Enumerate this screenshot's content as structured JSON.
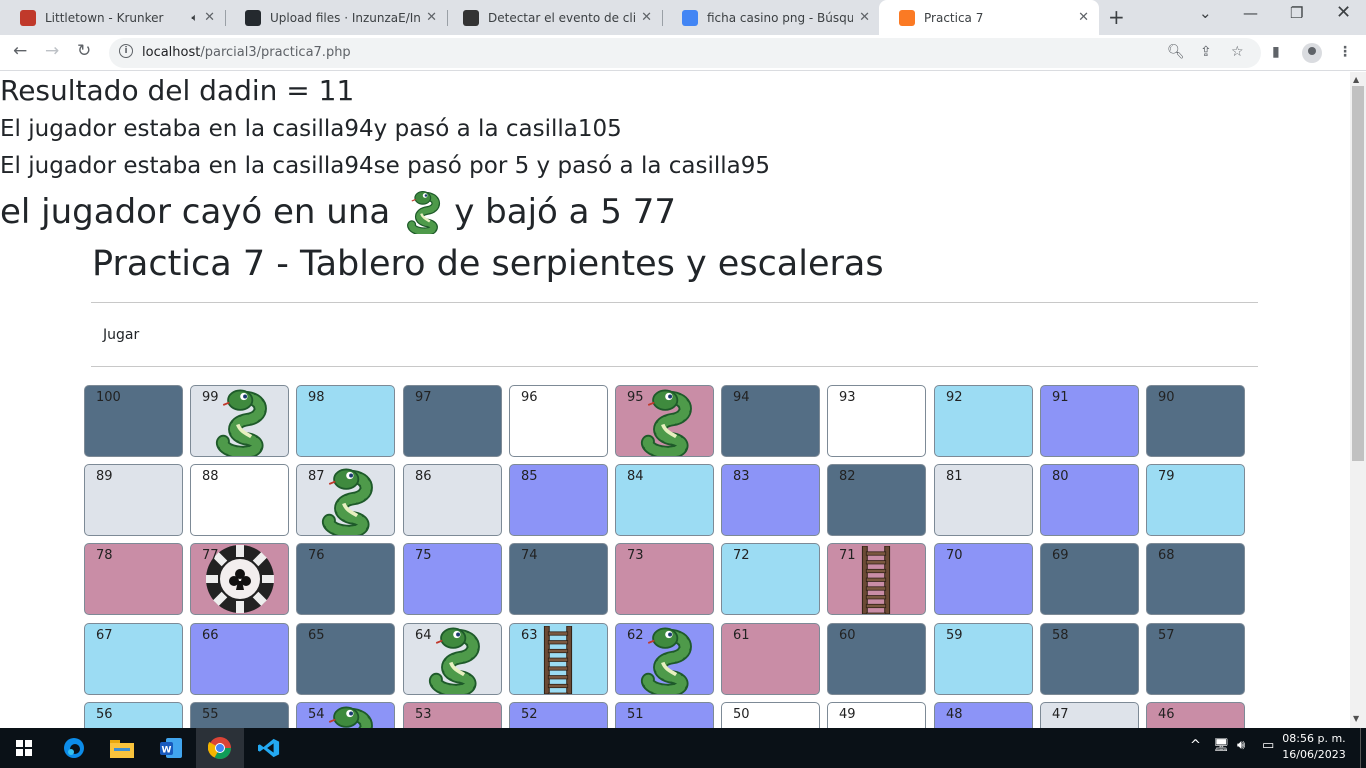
{
  "browser": {
    "tabs": [
      {
        "title": "Littletown - Krunker",
        "icon": "krunker-icon",
        "color": "#c0392b",
        "muted": true,
        "active": false
      },
      {
        "title": "Upload files · InzunzaE/Inzun",
        "icon": "github-icon",
        "color": "#24292e",
        "active": false
      },
      {
        "title": "Detectar el evento de clic del",
        "icon": "td-icon",
        "color": "#333333",
        "active": false
      },
      {
        "title": "ficha casino png - Búsqueda",
        "icon": "google-icon",
        "color": "#4285f4",
        "active": false
      },
      {
        "title": "Practica 7",
        "icon": "xampp-icon",
        "color": "#fb7a24",
        "active": true
      }
    ],
    "url_host": "localhost",
    "url_path": "/parcial3/practica7.php"
  },
  "page": {
    "result_line": "Resultado del dadin = 11",
    "move_line_1": "El jugador estaba en la casilla94y pasó a la casilla105",
    "move_line_2": "El jugador estaba en la casilla94se pasó por 5 y pasó a la casilla95",
    "snake_line_before": "el jugador cayó en una",
    "snake_line_after": "y bajó a 5 77",
    "title": "Practica 7 - Tablero de serpientes y escaleras",
    "play_link": "Jugar"
  },
  "board": {
    "rows": [
      [
        {
          "n": "100",
          "c": "slate"
        },
        {
          "n": "99",
          "c": "light",
          "i": "snake"
        },
        {
          "n": "98",
          "c": "sky"
        },
        {
          "n": "97",
          "c": "slate"
        },
        {
          "n": "96",
          "c": "white"
        },
        {
          "n": "95",
          "c": "pink",
          "i": "snake"
        },
        {
          "n": "94",
          "c": "slate"
        },
        {
          "n": "93",
          "c": "white"
        },
        {
          "n": "92",
          "c": "sky"
        },
        {
          "n": "91",
          "c": "blue"
        },
        {
          "n": "90",
          "c": "slate"
        }
      ],
      [
        {
          "n": "89",
          "c": "light"
        },
        {
          "n": "88",
          "c": "white"
        },
        {
          "n": "87",
          "c": "light",
          "i": "snake"
        },
        {
          "n": "86",
          "c": "light"
        },
        {
          "n": "85",
          "c": "blue"
        },
        {
          "n": "84",
          "c": "sky"
        },
        {
          "n": "83",
          "c": "blue"
        },
        {
          "n": "82",
          "c": "slate"
        },
        {
          "n": "81",
          "c": "light"
        },
        {
          "n": "80",
          "c": "blue"
        },
        {
          "n": "79",
          "c": "sky"
        }
      ],
      [
        {
          "n": "78",
          "c": "pink"
        },
        {
          "n": "77",
          "c": "pink",
          "i": "chip"
        },
        {
          "n": "76",
          "c": "slate"
        },
        {
          "n": "75",
          "c": "blue"
        },
        {
          "n": "74",
          "c": "slate"
        },
        {
          "n": "73",
          "c": "pink"
        },
        {
          "n": "72",
          "c": "sky"
        },
        {
          "n": "71",
          "c": "pink",
          "i": "ladder"
        },
        {
          "n": "70",
          "c": "blue"
        },
        {
          "n": "69",
          "c": "slate"
        },
        {
          "n": "68",
          "c": "slate"
        }
      ],
      [
        {
          "n": "67",
          "c": "sky"
        },
        {
          "n": "66",
          "c": "blue"
        },
        {
          "n": "65",
          "c": "slate"
        },
        {
          "n": "64",
          "c": "light",
          "i": "snake"
        },
        {
          "n": "63",
          "c": "sky",
          "i": "ladder"
        },
        {
          "n": "62",
          "c": "blue",
          "i": "snake"
        },
        {
          "n": "61",
          "c": "pink"
        },
        {
          "n": "60",
          "c": "slate"
        },
        {
          "n": "59",
          "c": "sky"
        },
        {
          "n": "58",
          "c": "slate"
        },
        {
          "n": "57",
          "c": "slate"
        }
      ],
      [
        {
          "n": "56",
          "c": "sky"
        },
        {
          "n": "55",
          "c": "slate"
        },
        {
          "n": "54",
          "c": "blue",
          "i": "snake"
        },
        {
          "n": "53",
          "c": "pink"
        },
        {
          "n": "52",
          "c": "blue"
        },
        {
          "n": "51",
          "c": "blue"
        },
        {
          "n": "50",
          "c": "white"
        },
        {
          "n": "49",
          "c": "white"
        },
        {
          "n": "48",
          "c": "blue"
        },
        {
          "n": "47",
          "c": "light"
        },
        {
          "n": "46",
          "c": "pink"
        }
      ]
    ]
  },
  "taskbar": {
    "apps": [
      "windows-start",
      "edge",
      "file-explorer",
      "word",
      "chrome",
      "vscode"
    ],
    "time": "08:56 p. m.",
    "date": "16/06/2023"
  }
}
